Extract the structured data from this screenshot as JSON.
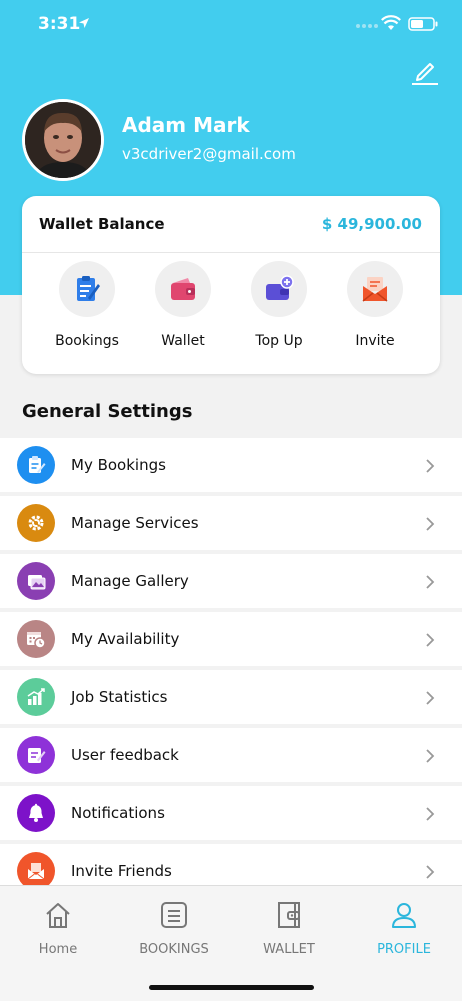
{
  "status": {
    "time": "3:31"
  },
  "profile": {
    "name": "Adam Mark",
    "email": "v3cdriver2@gmail.com"
  },
  "wallet": {
    "label": "Wallet Balance",
    "amount": "$ 49,900.00"
  },
  "quick_actions": [
    {
      "label": "Bookings",
      "icon": "clipboard-icon",
      "color": "#2f7ee9"
    },
    {
      "label": "Wallet",
      "icon": "wallet-icon",
      "color": "#e0466f"
    },
    {
      "label": "Top Up",
      "icon": "wallet-plus-icon",
      "color": "#5b4fd6"
    },
    {
      "label": "Invite",
      "icon": "envelope-icon",
      "color": "#f0552b"
    }
  ],
  "general_settings": {
    "title": "General Settings",
    "items": [
      {
        "label": "My Bookings",
        "icon": "clipboard-icon",
        "color": "#1e8ff0"
      },
      {
        "label": "Manage Services",
        "icon": "gear-icon",
        "color": "#d98a10"
      },
      {
        "label": "Manage Gallery",
        "icon": "gallery-icon",
        "color": "#8a3fb2"
      },
      {
        "label": "My Availability",
        "icon": "calendar-clock-icon",
        "color": "#b98585"
      },
      {
        "label": "Job Statistics",
        "icon": "bar-chart-icon",
        "color": "#5ccc9a"
      },
      {
        "label": "User feedback",
        "icon": "feedback-icon",
        "color": "#8e32d8"
      },
      {
        "label": "Notifications",
        "icon": "bell-icon",
        "color": "#7d12c9"
      },
      {
        "label": "Invite Friends",
        "icon": "envelope-icon",
        "color": "#f0552b"
      }
    ]
  },
  "tabbar": {
    "tabs": [
      {
        "label": "Home",
        "icon": "home-icon"
      },
      {
        "label": "BOOKINGS",
        "icon": "list-icon"
      },
      {
        "label": "WALLET",
        "icon": "wallet-icon"
      },
      {
        "label": "PROFILE",
        "icon": "user-icon"
      }
    ],
    "active": "PROFILE"
  },
  "colors": {
    "header": "#42cdee",
    "accent": "#2bb6dc"
  }
}
